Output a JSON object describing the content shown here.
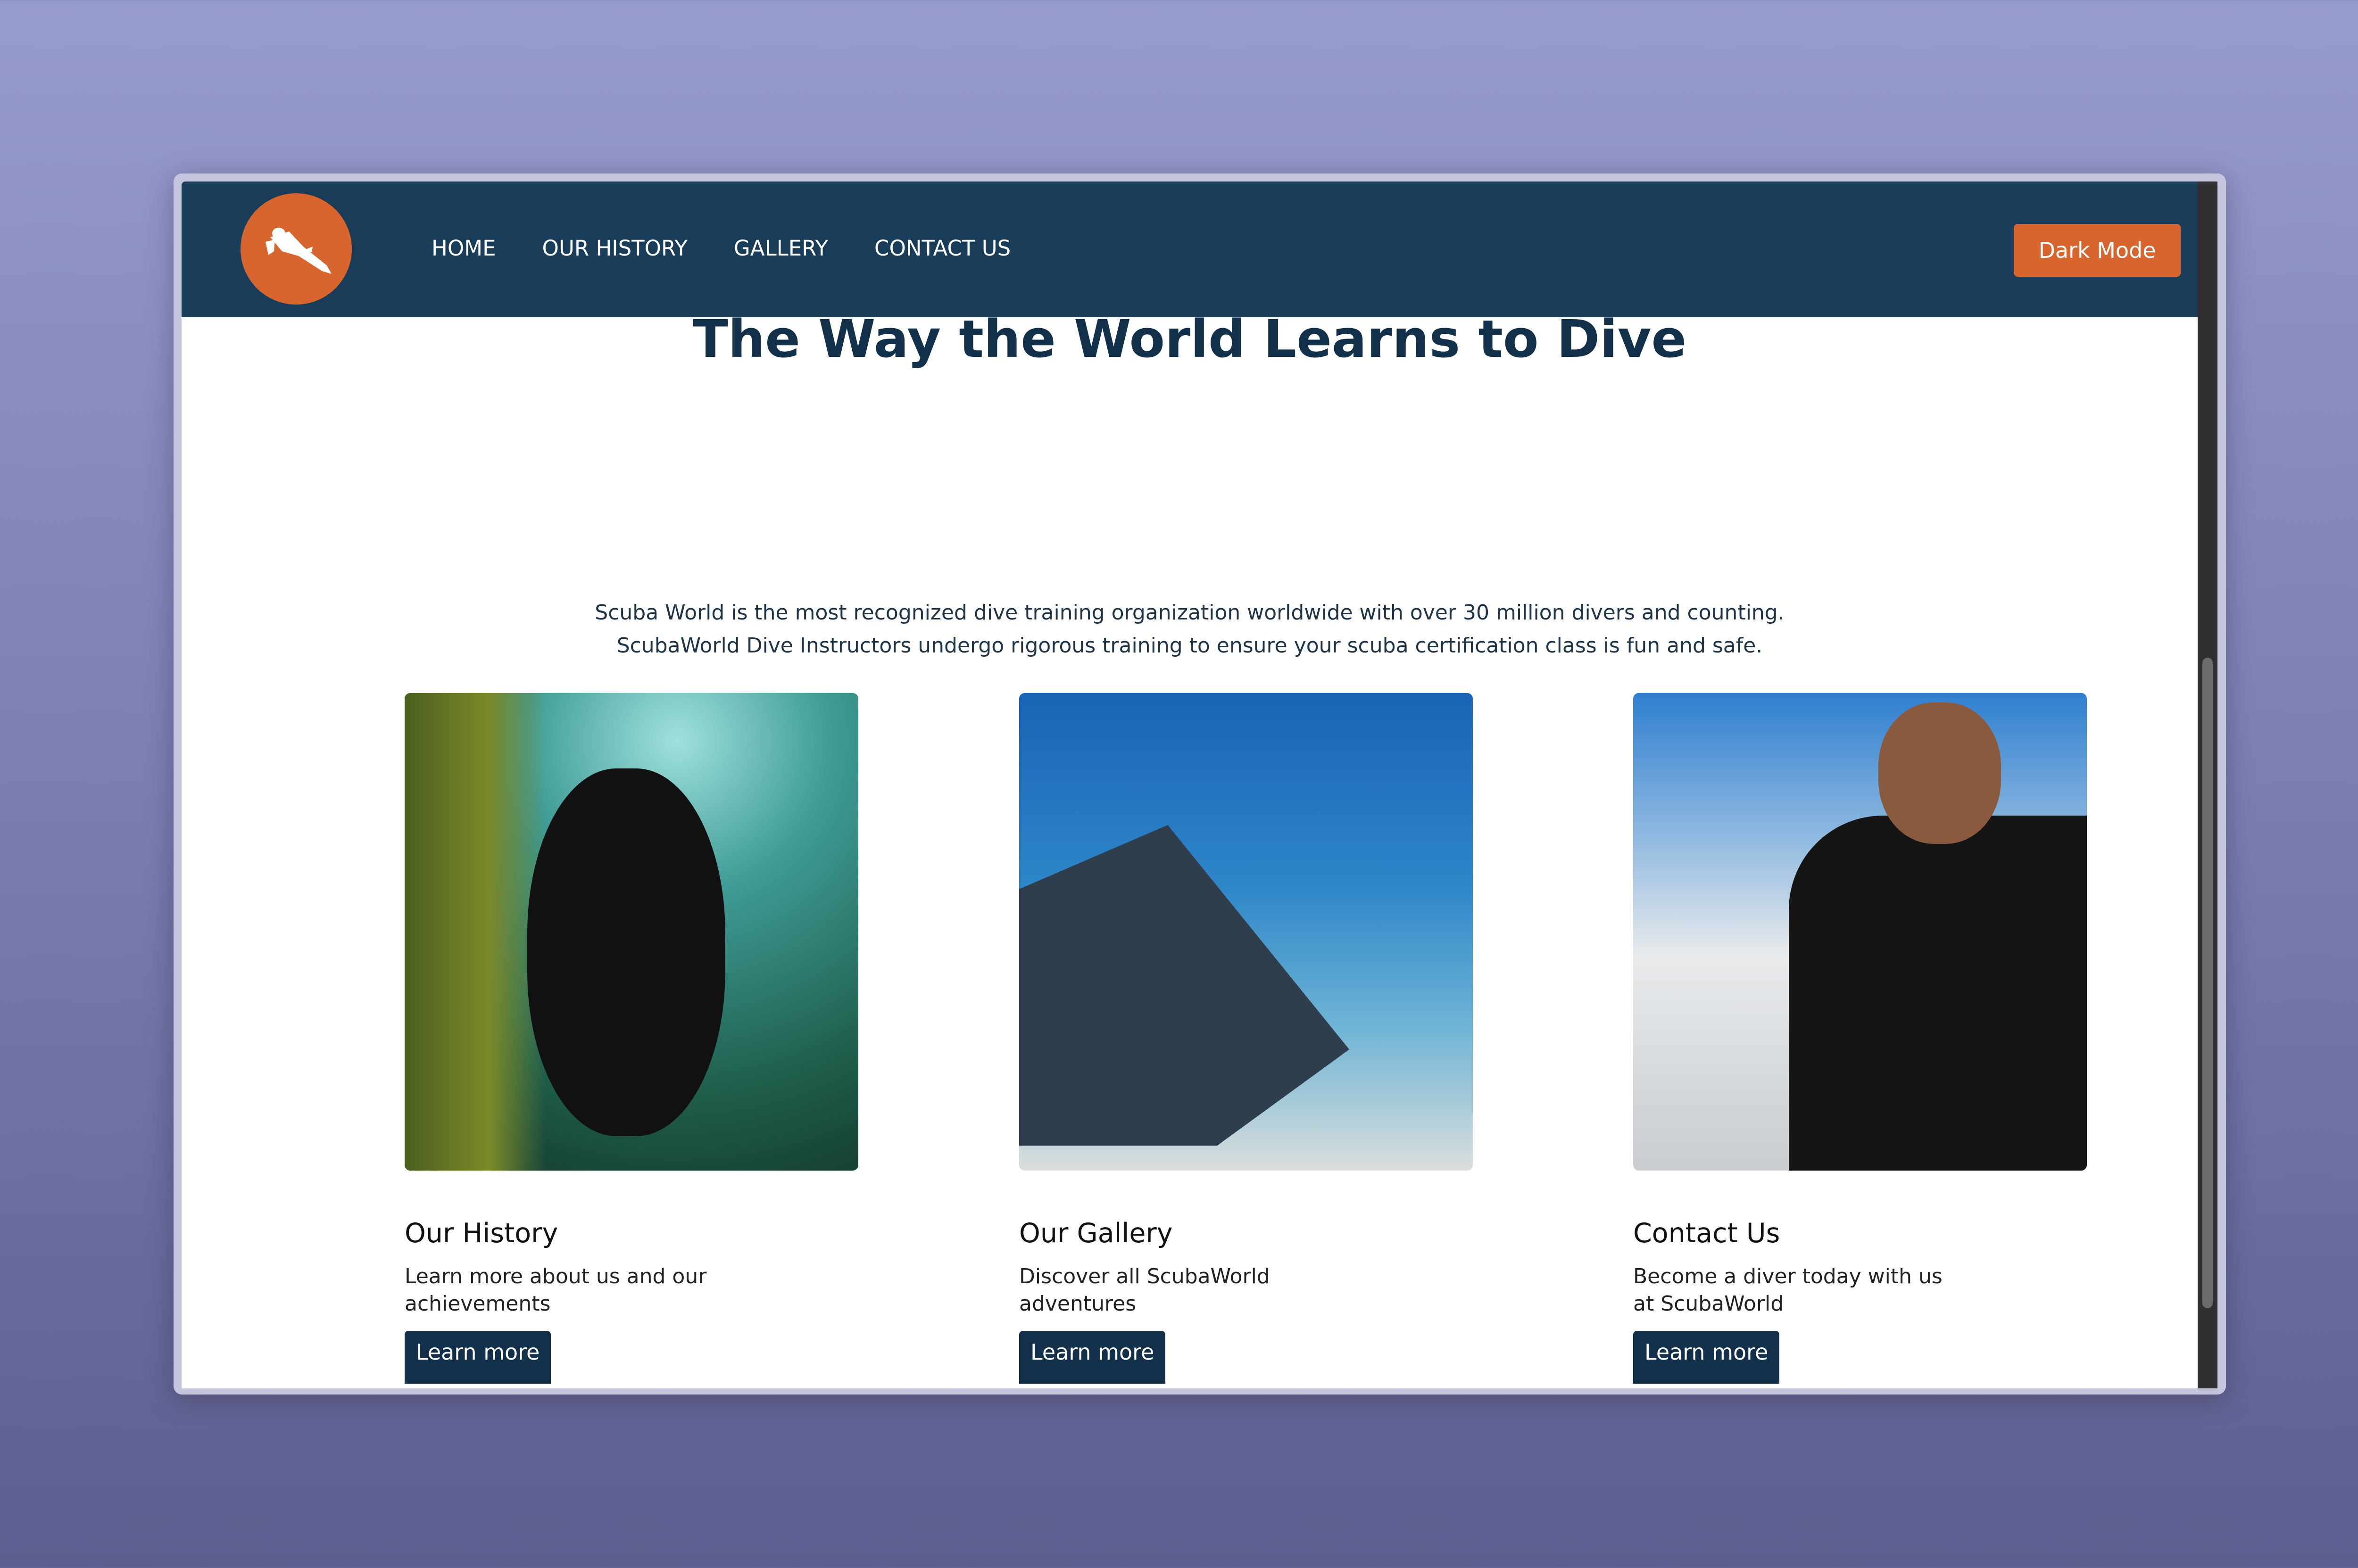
{
  "nav": {
    "items": [
      "HOME",
      "OUR HISTORY",
      "GALLERY",
      "CONTACT US"
    ],
    "dark_mode": "Dark Mode"
  },
  "hero": {
    "title": "The Way the World Learns to Dive",
    "lines": [
      "Scuba World is the most recognized dive training organization worldwide with over 30 million divers and counting.",
      "ScubaWorld Dive Instructors undergo rigorous training to ensure your scuba certification class is fun and safe."
    ]
  },
  "cards": [
    {
      "title": "Our History",
      "desc": "Learn more about us and our achievements",
      "button": "Learn more"
    },
    {
      "title": "Our Gallery",
      "desc": "Discover all ScubaWorld adventures",
      "button": "Learn more"
    },
    {
      "title": "Contact Us",
      "desc": "Become a diver today with us at ScubaWorld",
      "button": "Learn more"
    }
  ],
  "colors": {
    "header": "#193d59",
    "accent": "#d9652e",
    "button": "#13304a"
  }
}
